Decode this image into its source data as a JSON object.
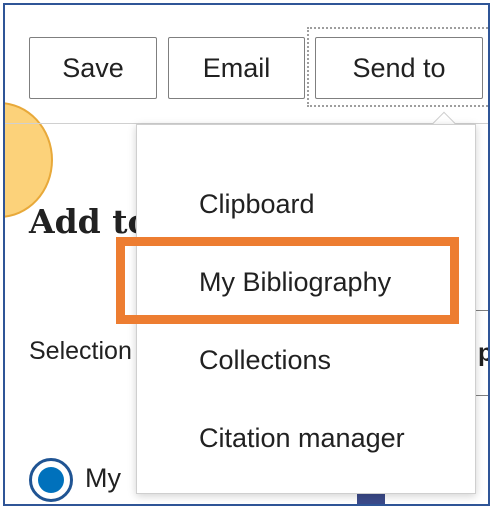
{
  "toolbar": {
    "save_label": "Save",
    "email_label": "Email",
    "send_to_label": "Send to"
  },
  "panel": {
    "title": "Add to",
    "selection_label": "Selection",
    "selection_value": "pa",
    "radio_label": "My",
    "radio_selected": true
  },
  "send_to_menu": {
    "items": [
      {
        "label": "Clipboard"
      },
      {
        "label": "My Bibliography"
      },
      {
        "label": "Collections"
      },
      {
        "label": "Citation manager"
      }
    ],
    "highlighted_item": "My Bibliography"
  },
  "colors": {
    "accent_highlight": "#ed7d31",
    "radio_blue": "#0071bc",
    "frame_border": "#2f5597",
    "step_bubble": "#fcd27a"
  }
}
